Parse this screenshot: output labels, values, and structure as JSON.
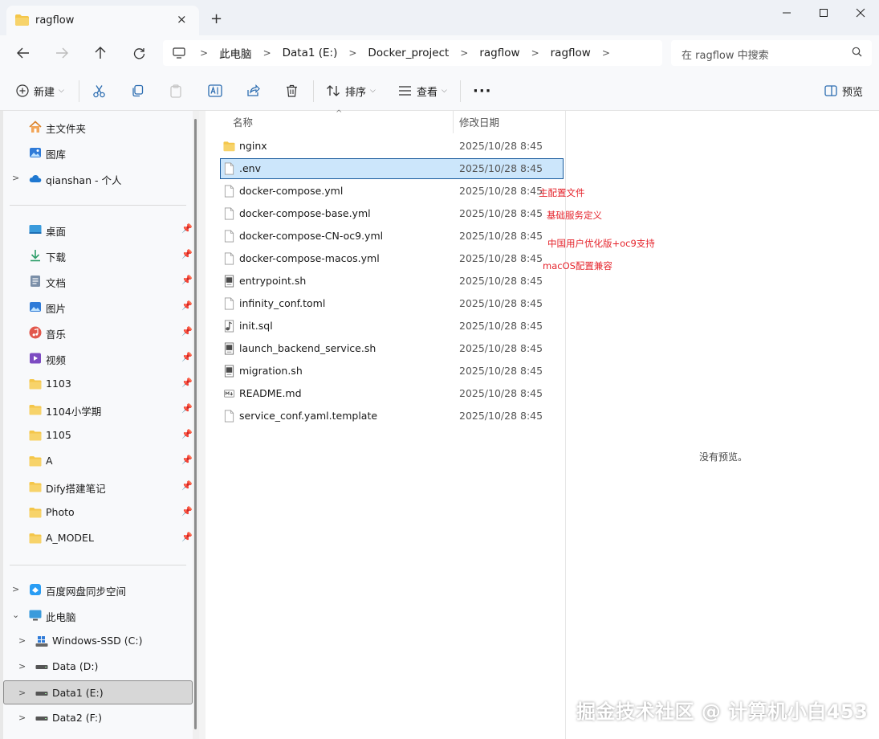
{
  "window": {
    "tab_title": "ragflow",
    "close_tab": "×",
    "new_tab": "+"
  },
  "address": {
    "segments": [
      "此电脑",
      "Data1 (E:)",
      "Docker_project",
      "ragflow",
      "ragflow"
    ],
    "search_placeholder": "在 ragflow 中搜索"
  },
  "toolbar": {
    "new_label": "新建",
    "sort_label": "排序",
    "view_label": "查看",
    "more_label": "···",
    "preview_label": "预览"
  },
  "sidebar": {
    "home": "主文件夹",
    "gallery": "图库",
    "onedrive": "qianshan - 个人",
    "pinned": [
      "桌面",
      "下载",
      "文档",
      "图片",
      "音乐",
      "视频",
      "1103",
      "1104小学期",
      "1105",
      "A",
      "Dify搭建笔记",
      "Photo",
      "A_MODEL"
    ],
    "baidu": "百度网盘同步空间",
    "this_pc": "此电脑",
    "drives": [
      "Windows-SSD (C:)",
      "Data (D:)",
      "Data1 (E:)",
      "Data2 (F:)"
    ]
  },
  "columns": {
    "name": "名称",
    "date": "修改日期"
  },
  "files": [
    {
      "name": "nginx",
      "date": "2025/10/28 8:45",
      "type": "folder"
    },
    {
      "name": ".env",
      "date": "2025/10/28 8:45",
      "type": "file"
    },
    {
      "name": "docker-compose.yml",
      "date": "2025/10/28 8:45",
      "type": "file"
    },
    {
      "name": "docker-compose-base.yml",
      "date": "2025/10/28 8:45",
      "type": "file"
    },
    {
      "name": "docker-compose-CN-oc9.yml",
      "date": "2025/10/28 8:45",
      "type": "file"
    },
    {
      "name": "docker-compose-macos.yml",
      "date": "2025/10/28 8:45",
      "type": "file"
    },
    {
      "name": "entrypoint.sh",
      "date": "2025/10/28 8:45",
      "type": "script"
    },
    {
      "name": "infinity_conf.toml",
      "date": "2025/10/28 8:45",
      "type": "file"
    },
    {
      "name": "init.sql",
      "date": "2025/10/28 8:45",
      "type": "sql"
    },
    {
      "name": "launch_backend_service.sh",
      "date": "2025/10/28 8:45",
      "type": "script"
    },
    {
      "name": "migration.sh",
      "date": "2025/10/28 8:45",
      "type": "script"
    },
    {
      "name": "README.md",
      "date": "2025/10/28 8:45",
      "type": "markdown"
    },
    {
      "name": "service_conf.yaml.template",
      "date": "2025/10/28 8:45",
      "type": "file"
    }
  ],
  "selected_file": ".env",
  "annotations": [
    "主配置文件",
    "基础服务定义",
    "中国用户优化版+oc9支持",
    "macOS配置兼容"
  ],
  "preview": {
    "empty_message": "没有预览。"
  },
  "watermark": "掘金技术社区 @ 计算机小白453",
  "colors": {
    "annotation": "#e5242c",
    "selection_fill": "#cce6fb",
    "selection_border": "#1a5c9e",
    "folder": "#f4c64a"
  }
}
